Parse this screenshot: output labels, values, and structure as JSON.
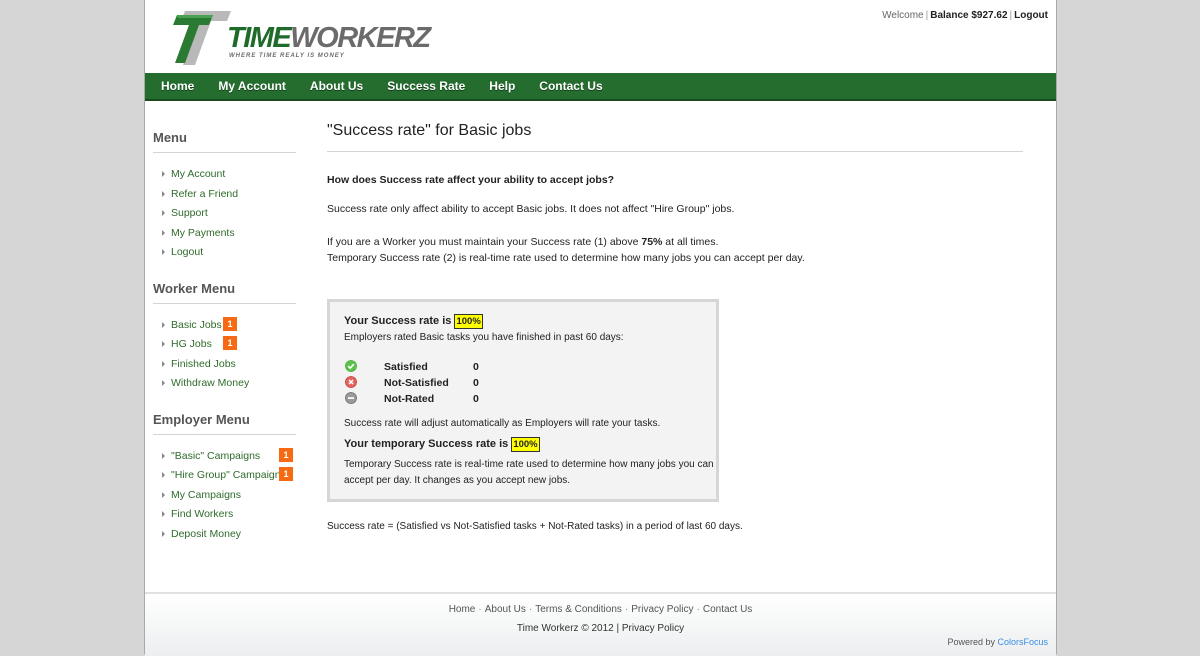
{
  "header": {
    "logo": {
      "brand_part1": "TIME",
      "brand_part2": "WORKERZ",
      "tagline": "WHERE TIME REALY IS MONEY"
    },
    "welcome": "Welcome",
    "balance_label": "Balance $927.62",
    "logout": "Logout"
  },
  "nav": {
    "items": [
      "Home",
      "My Account",
      "About Us",
      "Success Rate",
      "Help",
      "Contact Us"
    ]
  },
  "sidebar": {
    "menu": {
      "title": "Menu",
      "items": [
        "My Account",
        "Refer a Friend",
        "Support",
        "My Payments",
        "Logout"
      ]
    },
    "worker_menu": {
      "title": "Worker Menu",
      "items": [
        {
          "label": "Basic Jobs",
          "badge": "1"
        },
        {
          "label": "HG Jobs",
          "badge": "1"
        },
        {
          "label": "Finished Jobs"
        },
        {
          "label": "Withdraw Money"
        }
      ]
    },
    "employer_menu": {
      "title": "Employer Menu",
      "items": [
        {
          "label": "\"Basic\" Campaigns",
          "badge": "1"
        },
        {
          "label": "\"Hire Group\" Campaigns",
          "badge": "1"
        },
        {
          "label": "My Campaigns"
        },
        {
          "label": "Find Workers"
        },
        {
          "label": "Deposit Money"
        }
      ]
    },
    "badge_color": "#f56a12"
  },
  "content": {
    "title": "\"Success rate\" for Basic jobs",
    "question": "How does Success rate affect your ability to accept jobs?",
    "para1": "Success rate only affect ability to accept Basic jobs. It does not affect \"Hire Group\" jobs.",
    "para2_pre": "If you are a Worker you must maintain your Success rate (1) above ",
    "para2_bold": "75%",
    "para2_post": " at all times.",
    "para3": "Temporary Success rate (2) is real-time rate used to determine how many jobs you can accept per day.",
    "box": {
      "rate_label": "Your Success rate is",
      "rate_value": "100%",
      "rated_desc": "Employers rated Basic tasks you have finished in past 60 days:",
      "ratings": [
        {
          "icon": "check-circle-icon",
          "label": "Satisfied",
          "value": "0",
          "color": "#4caf3f"
        },
        {
          "icon": "x-circle-icon",
          "label": "Not-Satisfied",
          "value": "0",
          "color": "#d9534f"
        },
        {
          "icon": "minus-circle-icon",
          "label": "Not-Rated",
          "value": "0",
          "color": "#8a8a8a"
        }
      ],
      "adjust_note": "Success rate will adjust automatically as Employers will rate your tasks.",
      "temp_label": "Your temporary Success rate is",
      "temp_value": "100%",
      "temp_desc": "Temporary Success rate is real-time rate used to determine how many jobs you can accept per day. It changes as you accept new jobs."
    },
    "formula": "Success rate = (Satisfied vs Not-Satisfied tasks + Not-Rated tasks) in a period of last 60 days."
  },
  "footer": {
    "links": [
      "Home",
      "About Us",
      "Terms & Conditions",
      "Privacy Policy",
      "Contact Us"
    ],
    "copyright": "Time Workerz © 2012",
    "privacy": "Privacy Policy",
    "powered_by": "Powered by",
    "powered_link": "ColorsFocus"
  },
  "colors": {
    "nav_green": "#246d2f",
    "link_green": "#2f6b2b",
    "highlight_yellow": "#ffff00",
    "powered_link_blue": "#3a8ee6"
  }
}
